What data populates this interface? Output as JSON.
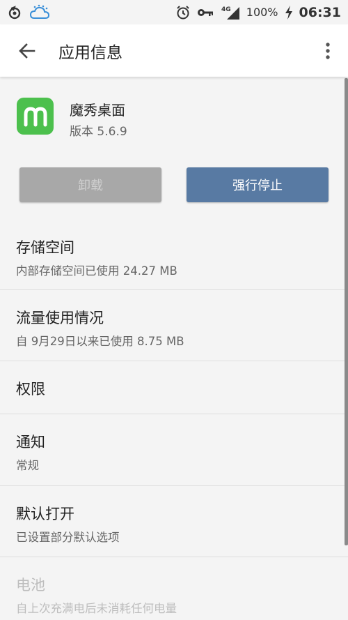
{
  "status_bar": {
    "time": "06:31",
    "battery": "100%",
    "network": "4G"
  },
  "app_bar": {
    "title": "应用信息"
  },
  "app": {
    "name": "魔秀桌面",
    "version": "版本 5.6.9",
    "icon_color": "#4cc04d"
  },
  "buttons": {
    "uninstall": "卸载",
    "force_stop": "强行停止"
  },
  "list": {
    "storage": {
      "title": "存储空间",
      "subtitle": "内部存储空间已使用 24.27 MB"
    },
    "data_usage": {
      "title": "流量使用情况",
      "subtitle": "自 9月29日以来已使用 8.75 MB"
    },
    "permissions": {
      "title": "权限"
    },
    "notifications": {
      "title": "通知",
      "subtitle": "常规"
    },
    "open_by_default": {
      "title": "默认打开",
      "subtitle": "已设置部分默认选项"
    },
    "battery": {
      "title": "电池",
      "subtitle": "自上次充满电后未消耗任何电量"
    }
  },
  "colors": {
    "accent": "#587aa3",
    "disabled_button": "#a8a8a8",
    "background": "#f4f4f4"
  }
}
